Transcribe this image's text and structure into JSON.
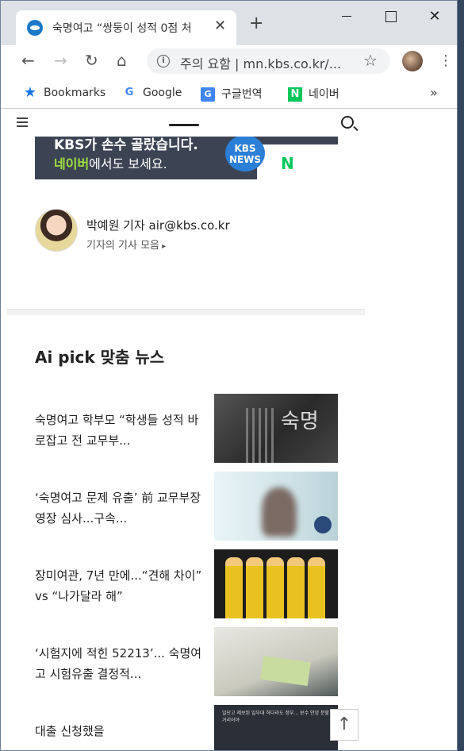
{
  "browser": {
    "tab_title": "숙명여고 “쌍둥이 성적 0점 처",
    "url_security": "주의 요함",
    "url_text": "mn.kbs.co.kr/...",
    "accent_color": "#1a73e8"
  },
  "bookmarks": {
    "items": [
      {
        "label": "Bookmarks",
        "icon": "star-icon"
      },
      {
        "label": "Google",
        "icon": "google-icon"
      },
      {
        "label": "구글번역",
        "icon": "translate-icon"
      },
      {
        "label": "네이버",
        "icon": "naver-icon"
      }
    ],
    "more": "»"
  },
  "banner": {
    "line1": "KBS가 손수 골랐습니다.",
    "line2_highlight": "네이버",
    "line2_rest": "에서도 보세요.",
    "kbs_line1": "KBS",
    "kbs_line2": "NEWS",
    "naver_letter": "N"
  },
  "author": {
    "name": "박예원 기자 air@kbs.co.kr",
    "link": "기자의 기사 모음"
  },
  "section": {
    "title": "Ai pick 맞춤 뉴스"
  },
  "news": [
    {
      "title": "숙명여고 학부모 “학생들 성적 바로잡고 전 교무부..."
    },
    {
      "title": "‘숙명여고 문제 유출’ 前 교무부장 영장 심사...구속..."
    },
    {
      "title": "장미여관, 7년 만에...“견해 차이” vs “나가달라 해”"
    },
    {
      "title": "‘시험지에 적힌 52213’... 숙명여고 시험유출 결정적..."
    },
    {
      "title": "대출 신청했을"
    }
  ],
  "thumb_text": {
    "t1": "숙명",
    "t5": "일단고 제보된 일부대 하다라도 정부... 보수 안녕 분할거리어야"
  }
}
